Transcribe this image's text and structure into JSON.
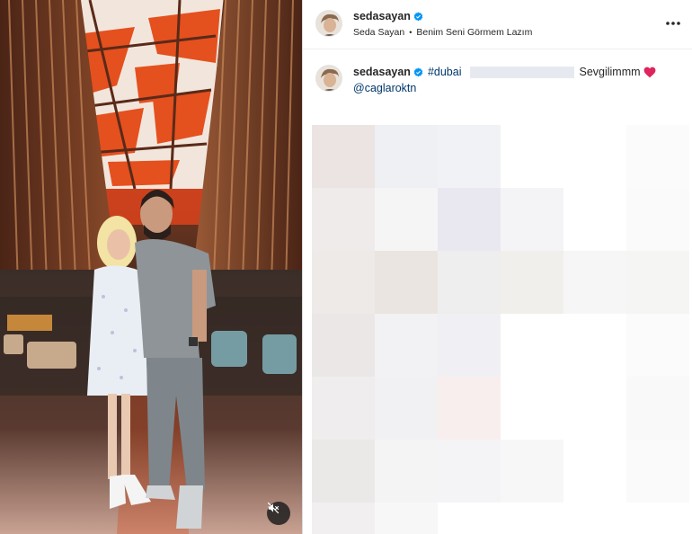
{
  "post": {
    "author": {
      "username": "sedasayan",
      "verified": true
    },
    "audio": {
      "artist": "Seda Sayan",
      "separator": "•",
      "song": "Benim Seni Görmem Lazım"
    },
    "caption": {
      "username": "sedasayan",
      "hashtag": "#dubai",
      "text": "Sevgilimmm",
      "emoji": "red-heart",
      "mention": "@caglaroktn"
    }
  },
  "media": {
    "mute_button_icon": "speaker-muted-icon"
  },
  "icons": {
    "more": "more-options-icon",
    "verified": "verified-badge-icon"
  },
  "colors": {
    "link": "#00376b",
    "verified": "#0095f6",
    "heart": "#e0245e",
    "text": "#262626"
  }
}
